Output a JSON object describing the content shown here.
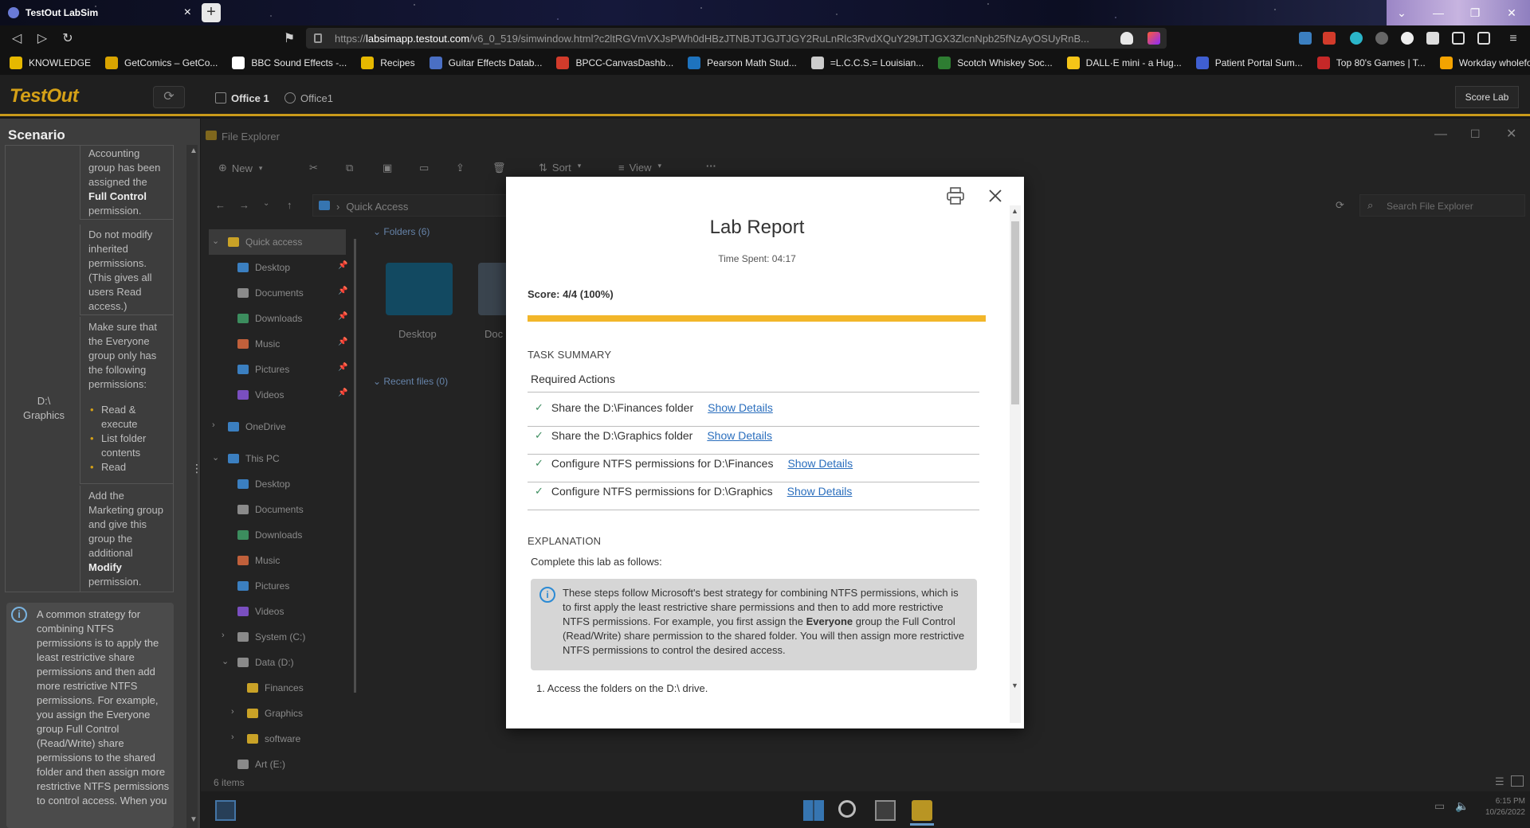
{
  "browser": {
    "tab_title": "TestOut LabSim",
    "tab_close": "×",
    "new_tab": "+",
    "url_prefix": "https://",
    "url_domain": "labsimapp.testout.com",
    "url_path": "/v6_0_519/simwindow.html?c2ltRGVmVXJsPWh0dHBzJTNBJTJGJTJGY2RuLnRlc3RvdXQuY29tJTJGX3ZlcnNpb25fNzAyOSUyRnB...",
    "bookmarks": [
      {
        "label": "KNOWLEDGE",
        "color": "#e6b800"
      },
      {
        "label": "GetComics – GetCo...",
        "color": "#d9a400"
      },
      {
        "label": "BBC Sound Effects -...",
        "color": "#ffffff"
      },
      {
        "label": "Recipes",
        "color": "#e6b800"
      },
      {
        "label": "Guitar Effects Datab...",
        "color": "#4a6fc4"
      },
      {
        "label": "BPCC-CanvasDashb...",
        "color": "#d23b2b"
      },
      {
        "label": "Pearson Math Stud...",
        "color": "#1e73be"
      },
      {
        "label": "=L.C.C.S.= Louisian...",
        "color": "#cccccc"
      },
      {
        "label": "Scotch Whiskey Soc...",
        "color": "#2e7d32"
      },
      {
        "label": "DALL·E mini - a Hug...",
        "color": "#f5c518"
      },
      {
        "label": "Patient Portal Sum...",
        "color": "#3f5fd1"
      },
      {
        "label": "Top 80's Games | T...",
        "color": "#c62828"
      },
      {
        "label": "Workday wholefoo...",
        "color": "#f4a300"
      }
    ]
  },
  "app": {
    "logo": "TestOut",
    "tab1": "Office 1",
    "tab2": "Office1",
    "score_lab": "Score Lab"
  },
  "scenario": {
    "title": "Scenario",
    "row1_pre": "Accounting group has been assigned the ",
    "row1_bold": "Full Control",
    "row1_post": " permission.",
    "row2": "Do not modify inherited permissions. (This gives all users Read access.)",
    "row3": "Make sure that the Everyone group only has the following permissions:",
    "row3_items": [
      "Read & execute",
      "List folder contents",
      "Read"
    ],
    "row4_pre": "Add the Marketing group and give this group the additional ",
    "row4_bold": "Modify",
    "row4_post": " permission.",
    "label_line1": "D:\\",
    "label_line2": "Graphics",
    "tip": "A common strategy for combining NTFS permissions is to apply the least restrictive share permissions and then add more restrictive NTFS permissions. For example, you assign the Everyone group Full Control (Read/Write) share permissions to the shared folder and then assign more restrictive NTFS permissions to control access. When you"
  },
  "explorer": {
    "title": "File Explorer",
    "new": "New",
    "sort": "Sort",
    "view": "View",
    "more": "···",
    "breadcrumb": "Quick Access",
    "search_placeholder": "Search File Explorer",
    "folders_header": "Folders (6)",
    "recent_header": "Recent files (0)",
    "folder1": "Desktop",
    "folder2": "Doc",
    "status": "6 items",
    "sidebar": [
      {
        "label": "Quick access",
        "color": "#c9a227"
      },
      {
        "label": "Desktop",
        "color": "#3b7fc0"
      },
      {
        "label": "Documents",
        "color": "#8a8a8a"
      },
      {
        "label": "Downloads",
        "color": "#3c8d5e"
      },
      {
        "label": "Music",
        "color": "#c0603b"
      },
      {
        "label": "Pictures",
        "color": "#3b7fc0"
      },
      {
        "label": "Videos",
        "color": "#7a4fc0"
      },
      {
        "label": "OneDrive",
        "color": "#3b7fc0"
      },
      {
        "label": "This PC",
        "color": "#3b7fc0"
      },
      {
        "label": "Desktop",
        "color": "#3b7fc0"
      },
      {
        "label": "Documents",
        "color": "#8a8a8a"
      },
      {
        "label": "Downloads",
        "color": "#3c8d5e"
      },
      {
        "label": "Music",
        "color": "#c0603b"
      },
      {
        "label": "Pictures",
        "color": "#3b7fc0"
      },
      {
        "label": "Videos",
        "color": "#7a4fc0"
      },
      {
        "label": "System (C:)",
        "color": "#8a8a8a"
      },
      {
        "label": "Data (D:)",
        "color": "#8a8a8a"
      },
      {
        "label": "Finances",
        "color": "#c9a227"
      },
      {
        "label": "Graphics",
        "color": "#c9a227"
      },
      {
        "label": "software",
        "color": "#c9a227"
      },
      {
        "label": "Art (E:)",
        "color": "#8a8a8a"
      }
    ],
    "clock_time": "6:15 PM",
    "clock_date": "10/26/2022"
  },
  "report": {
    "title": "Lab Report",
    "time_spent": "Time Spent: 04:17",
    "score": "Score: 4/4 (100%)",
    "progress_percent": 100,
    "task_summary": "TASK SUMMARY",
    "required_actions": "Required Actions",
    "tasks": [
      {
        "label": "Share the D:\\Finances folder",
        "link": "Show Details"
      },
      {
        "label": "Share the D:\\Graphics folder",
        "link": "Show Details"
      },
      {
        "label": "Configure NTFS permissions for D:\\Finances",
        "link": "Show Details"
      },
      {
        "label": "Configure NTFS permissions for D:\\Graphics",
        "link": "Show Details"
      }
    ],
    "explanation": "EXPLANATION",
    "complete_intro": "Complete this lab as follows:",
    "note_pre": "These steps follow Microsoft's best strategy for combining NTFS permissions, which is to first apply the least restrictive share permissions and then to add more restrictive NTFS permissions. For example, you first assign the ",
    "note_bold": "Everyone",
    "note_post": " group the Full Control (Read/Write) share permission to the shared folder. You will then assign more restrictive NTFS permissions to control the desired access.",
    "step1": "1. Access the folders on the D:\\ drive."
  }
}
